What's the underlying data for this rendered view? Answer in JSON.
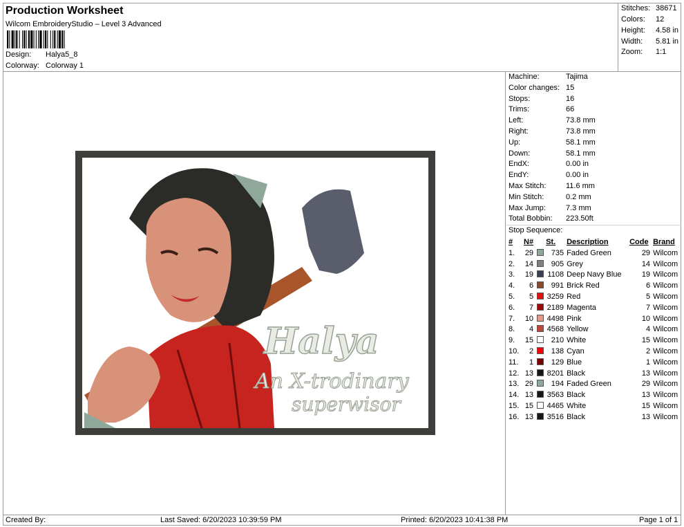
{
  "header": {
    "title": "Production Worksheet",
    "software": "Wilcom EmbroideryStudio – Level 3 Advanced",
    "design_label": "Design:",
    "design_value": "Halya5_8",
    "colorway_label": "Colorway:",
    "colorway_value": "Colorway 1"
  },
  "summary": {
    "stitches_label": "Stitches:",
    "stitches": "38671",
    "colors_label": "Colors:",
    "colors": "12",
    "height_label": "Height:",
    "height": "4.58 in",
    "width_label": "Width:",
    "width": "5.81 in",
    "zoom_label": "Zoom:",
    "zoom": "1:1"
  },
  "machine": [
    {
      "label": "Machine:",
      "value": "Tajima"
    },
    {
      "label": "Color changes:",
      "value": "15"
    },
    {
      "label": "Stops:",
      "value": "16"
    },
    {
      "label": "Trims:",
      "value": "66"
    },
    {
      "label": "Left:",
      "value": "73.8 mm"
    },
    {
      "label": "Right:",
      "value": "73.8 mm"
    },
    {
      "label": "Up:",
      "value": "58.1 mm"
    },
    {
      "label": "Down:",
      "value": "58.1 mm"
    },
    {
      "label": "EndX:",
      "value": "0.00 in"
    },
    {
      "label": "EndY:",
      "value": "0.00 in"
    },
    {
      "label": "Max Stitch:",
      "value": "11.6 mm"
    },
    {
      "label": "Min Stitch:",
      "value": "0.2 mm"
    },
    {
      "label": "Max Jump:",
      "value": "7.3 mm"
    },
    {
      "label": "Total Bobbin:",
      "value": "223.50ft"
    }
  ],
  "stop_sequence_label": "Stop Sequence:",
  "stops_headers": {
    "idx": "#",
    "n": "N#",
    "st": "St.",
    "desc": "Description",
    "code": "Code",
    "brand": "Brand"
  },
  "stops": [
    {
      "idx": "1.",
      "n": "29",
      "color": "#8fa89a",
      "st": "735",
      "desc": "Faded Green",
      "code": "29",
      "brand": "Wilcom"
    },
    {
      "idx": "2.",
      "n": "14",
      "color": "#808080",
      "st": "905",
      "desc": "Grey",
      "code": "14",
      "brand": "Wilcom"
    },
    {
      "idx": "3.",
      "n": "19",
      "color": "#3b3f52",
      "st": "1108",
      "desc": "Deep Navy Blue",
      "code": "19",
      "brand": "Wilcom"
    },
    {
      "idx": "4.",
      "n": "6",
      "color": "#8b4a2b",
      "st": "991",
      "desc": "Brick Red",
      "code": "6",
      "brand": "Wilcom"
    },
    {
      "idx": "5.",
      "n": "5",
      "color": "#e01010",
      "st": "3259",
      "desc": "Red",
      "code": "5",
      "brand": "Wilcom"
    },
    {
      "idx": "6.",
      "n": "7",
      "color": "#9a0a0a",
      "st": "2189",
      "desc": "Magenta",
      "code": "7",
      "brand": "Wilcom"
    },
    {
      "idx": "7.",
      "n": "10",
      "color": "#e8968a",
      "st": "4498",
      "desc": "Pink",
      "code": "10",
      "brand": "Wilcom"
    },
    {
      "idx": "8.",
      "n": "4",
      "color": "#c0463a",
      "st": "4568",
      "desc": "Yellow",
      "code": "4",
      "brand": "Wilcom"
    },
    {
      "idx": "9.",
      "n": "15",
      "color": "#ffffff",
      "st": "210",
      "desc": "White",
      "code": "15",
      "brand": "Wilcom"
    },
    {
      "idx": "10.",
      "n": "2",
      "color": "#ff0000",
      "st": "138",
      "desc": "Cyan",
      "code": "2",
      "brand": "Wilcom"
    },
    {
      "idx": "11.",
      "n": "1",
      "color": "#7a0000",
      "st": "129",
      "desc": "Blue",
      "code": "1",
      "brand": "Wilcom"
    },
    {
      "idx": "12.",
      "n": "13",
      "color": "#161616",
      "st": "8201",
      "desc": "Black",
      "code": "13",
      "brand": "Wilcom"
    },
    {
      "idx": "13.",
      "n": "29",
      "color": "#8fa89a",
      "st": "194",
      "desc": "Faded Green",
      "code": "29",
      "brand": "Wilcom"
    },
    {
      "idx": "14.",
      "n": "13",
      "color": "#161616",
      "st": "3563",
      "desc": "Black",
      "code": "13",
      "brand": "Wilcom"
    },
    {
      "idx": "15.",
      "n": "15",
      "color": "#ffffff",
      "st": "4465",
      "desc": "White",
      "code": "15",
      "brand": "Wilcom"
    },
    {
      "idx": "16.",
      "n": "13",
      "color": "#161616",
      "st": "3516",
      "desc": "Black",
      "code": "13",
      "brand": "Wilcom"
    }
  ],
  "artwork": {
    "title": "Halya",
    "line1": "An X-trodinary",
    "line2": "superwisor"
  },
  "footer": {
    "created_by": "Created By:",
    "last_saved": "Last Saved: 6/20/2023 10:39:59 PM",
    "printed": "Printed: 6/20/2023 10:41:38 PM",
    "page": "Page 1 of 1"
  }
}
